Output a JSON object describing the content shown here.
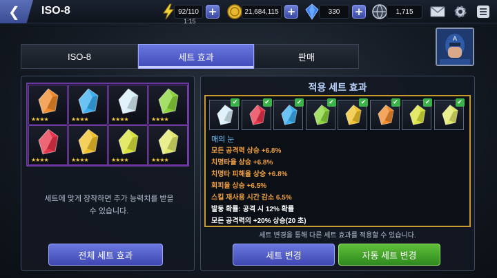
{
  "header": {
    "title": "ISO-8",
    "energy": "92/110",
    "energy_timer": "1:15",
    "gold": "21,684,115",
    "crystals": "330",
    "third_currency": "1,715"
  },
  "tabs": [
    {
      "label": "ISO-8"
    },
    {
      "label": "세트 효과"
    },
    {
      "label": "판매"
    }
  ],
  "left_panel": {
    "slots": [
      {
        "color": "#f08a2a",
        "stars": "★★★★"
      },
      {
        "color": "#3aaef0",
        "stars": "★★★★"
      },
      {
        "color": "#d8eef8",
        "stars": "★★★★"
      },
      {
        "color": "#8ad43a",
        "stars": "★★★★"
      },
      {
        "color": "#e8344a",
        "stars": "★★★★"
      },
      {
        "color": "#f0c22a",
        "stars": "★★★★"
      },
      {
        "color": "#d8e23a",
        "stars": "★★★★"
      },
      {
        "color": "#e2e86a",
        "stars": "★★★★"
      }
    ],
    "message_line1": "세트에 맞게 장착하면 추가 능력치를 받을",
    "message_line2": "수 있습니다.",
    "all_sets_button": "전체 세트 효과"
  },
  "right_panel": {
    "title": "적용 세트 효과",
    "slots": [
      {
        "color": "#d8eef8"
      },
      {
        "color": "#e8344a"
      },
      {
        "color": "#3aaef0"
      },
      {
        "color": "#8ad43a"
      },
      {
        "color": "#f0c22a"
      },
      {
        "color": "#f08a2a"
      },
      {
        "color": "#d8e23a"
      },
      {
        "color": "#e2e86a"
      }
    ],
    "check_mark": "✔",
    "set_name": "매의 눈",
    "effects": [
      "모든 공격력 상승 +6.8%",
      "치명타율 상승 +6.8%",
      "치명타 피해율 상승 +6.8%",
      "회피율 상승 +6.5%",
      "스킬 재사용 시간 감소 6.5%"
    ],
    "proc_effects": [
      "발동 확률: 공격 시 12% 확률",
      "모든 공격력의 +20% 상승(20 초)"
    ],
    "note": "세트 변경을 통해 다른 세트 효과를 적용할 수 있습니다.",
    "change_set_button": "세트 변경",
    "auto_change_button": "자동 세트 변경"
  },
  "colors": {
    "accent": "#4f5bd0",
    "gold_frame": "#c99a2e",
    "purple_frame": "#6a3aa0",
    "effect_text": "#f0a040",
    "set_name": "#6fc6ff"
  }
}
